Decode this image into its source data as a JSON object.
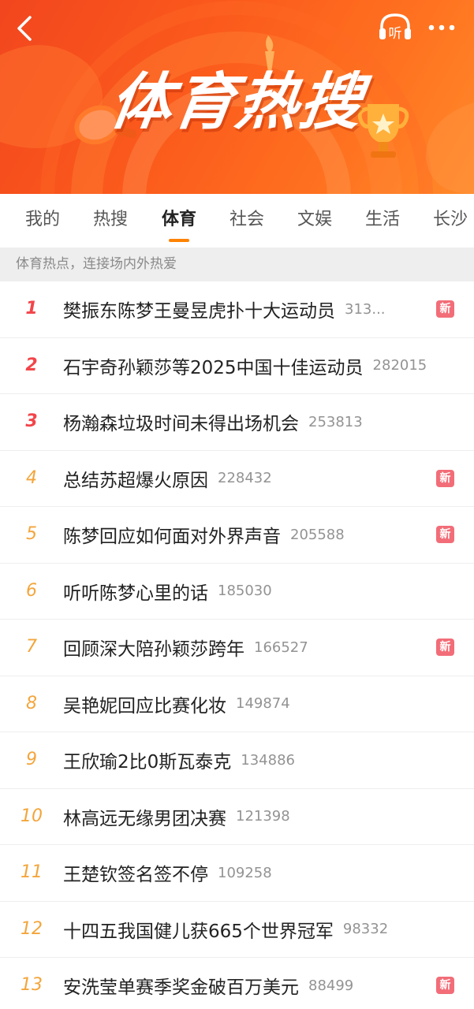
{
  "header": {
    "title": "体育热搜",
    "back_icon": "chevron-left-icon",
    "listen_icon": "headphones-icon",
    "listen_label": "听",
    "more_icon": "more-dots-icon",
    "more_label": "•••"
  },
  "tabs": [
    {
      "label": "我的",
      "active": false
    },
    {
      "label": "热搜",
      "active": false
    },
    {
      "label": "体育",
      "active": true
    },
    {
      "label": "社会",
      "active": false
    },
    {
      "label": "文娱",
      "active": false
    },
    {
      "label": "生活",
      "active": false
    },
    {
      "label": "长沙",
      "active": false
    }
  ],
  "subtitle": "体育热点，连接场内外热爱",
  "colors": {
    "banner_start": "#f2461e",
    "banner_end": "#ff8a2a",
    "rank_top": "#f2454a",
    "rank_normal": "#f3a53b",
    "badge_new": "#f26d78",
    "tab_underline": "#ff8200"
  },
  "badge_label": "新",
  "items": [
    {
      "rank": "1",
      "title": "樊振东陈梦王曼昱虎扑十大运动员",
      "count": "313...",
      "badge": true
    },
    {
      "rank": "2",
      "title": "石宇奇孙颖莎等2025中国十佳运动员",
      "count": "282015",
      "badge": false
    },
    {
      "rank": "3",
      "title": "杨瀚森垃圾时间未得出场机会",
      "count": "253813",
      "badge": false
    },
    {
      "rank": "4",
      "title": "总结苏超爆火原因",
      "count": "228432",
      "badge": true
    },
    {
      "rank": "5",
      "title": "陈梦回应如何面对外界声音",
      "count": "205588",
      "badge": true
    },
    {
      "rank": "6",
      "title": "听听陈梦心里的话",
      "count": "185030",
      "badge": false
    },
    {
      "rank": "7",
      "title": "回顾深大陪孙颖莎跨年",
      "count": "166527",
      "badge": true
    },
    {
      "rank": "8",
      "title": "吴艳妮回应比赛化妆",
      "count": "149874",
      "badge": false
    },
    {
      "rank": "9",
      "title": "王欣瑜2比0斯瓦泰克",
      "count": "134886",
      "badge": false
    },
    {
      "rank": "10",
      "title": "林高远无缘男团决赛",
      "count": "121398",
      "badge": false
    },
    {
      "rank": "11",
      "title": "王楚钦签名签不停",
      "count": "109258",
      "badge": false
    },
    {
      "rank": "12",
      "title": "十四五我国健儿获665个世界冠军",
      "count": "98332",
      "badge": false
    },
    {
      "rank": "13",
      "title": "安洗莹单赛季奖金破百万美元",
      "count": "88499",
      "badge": true
    }
  ]
}
